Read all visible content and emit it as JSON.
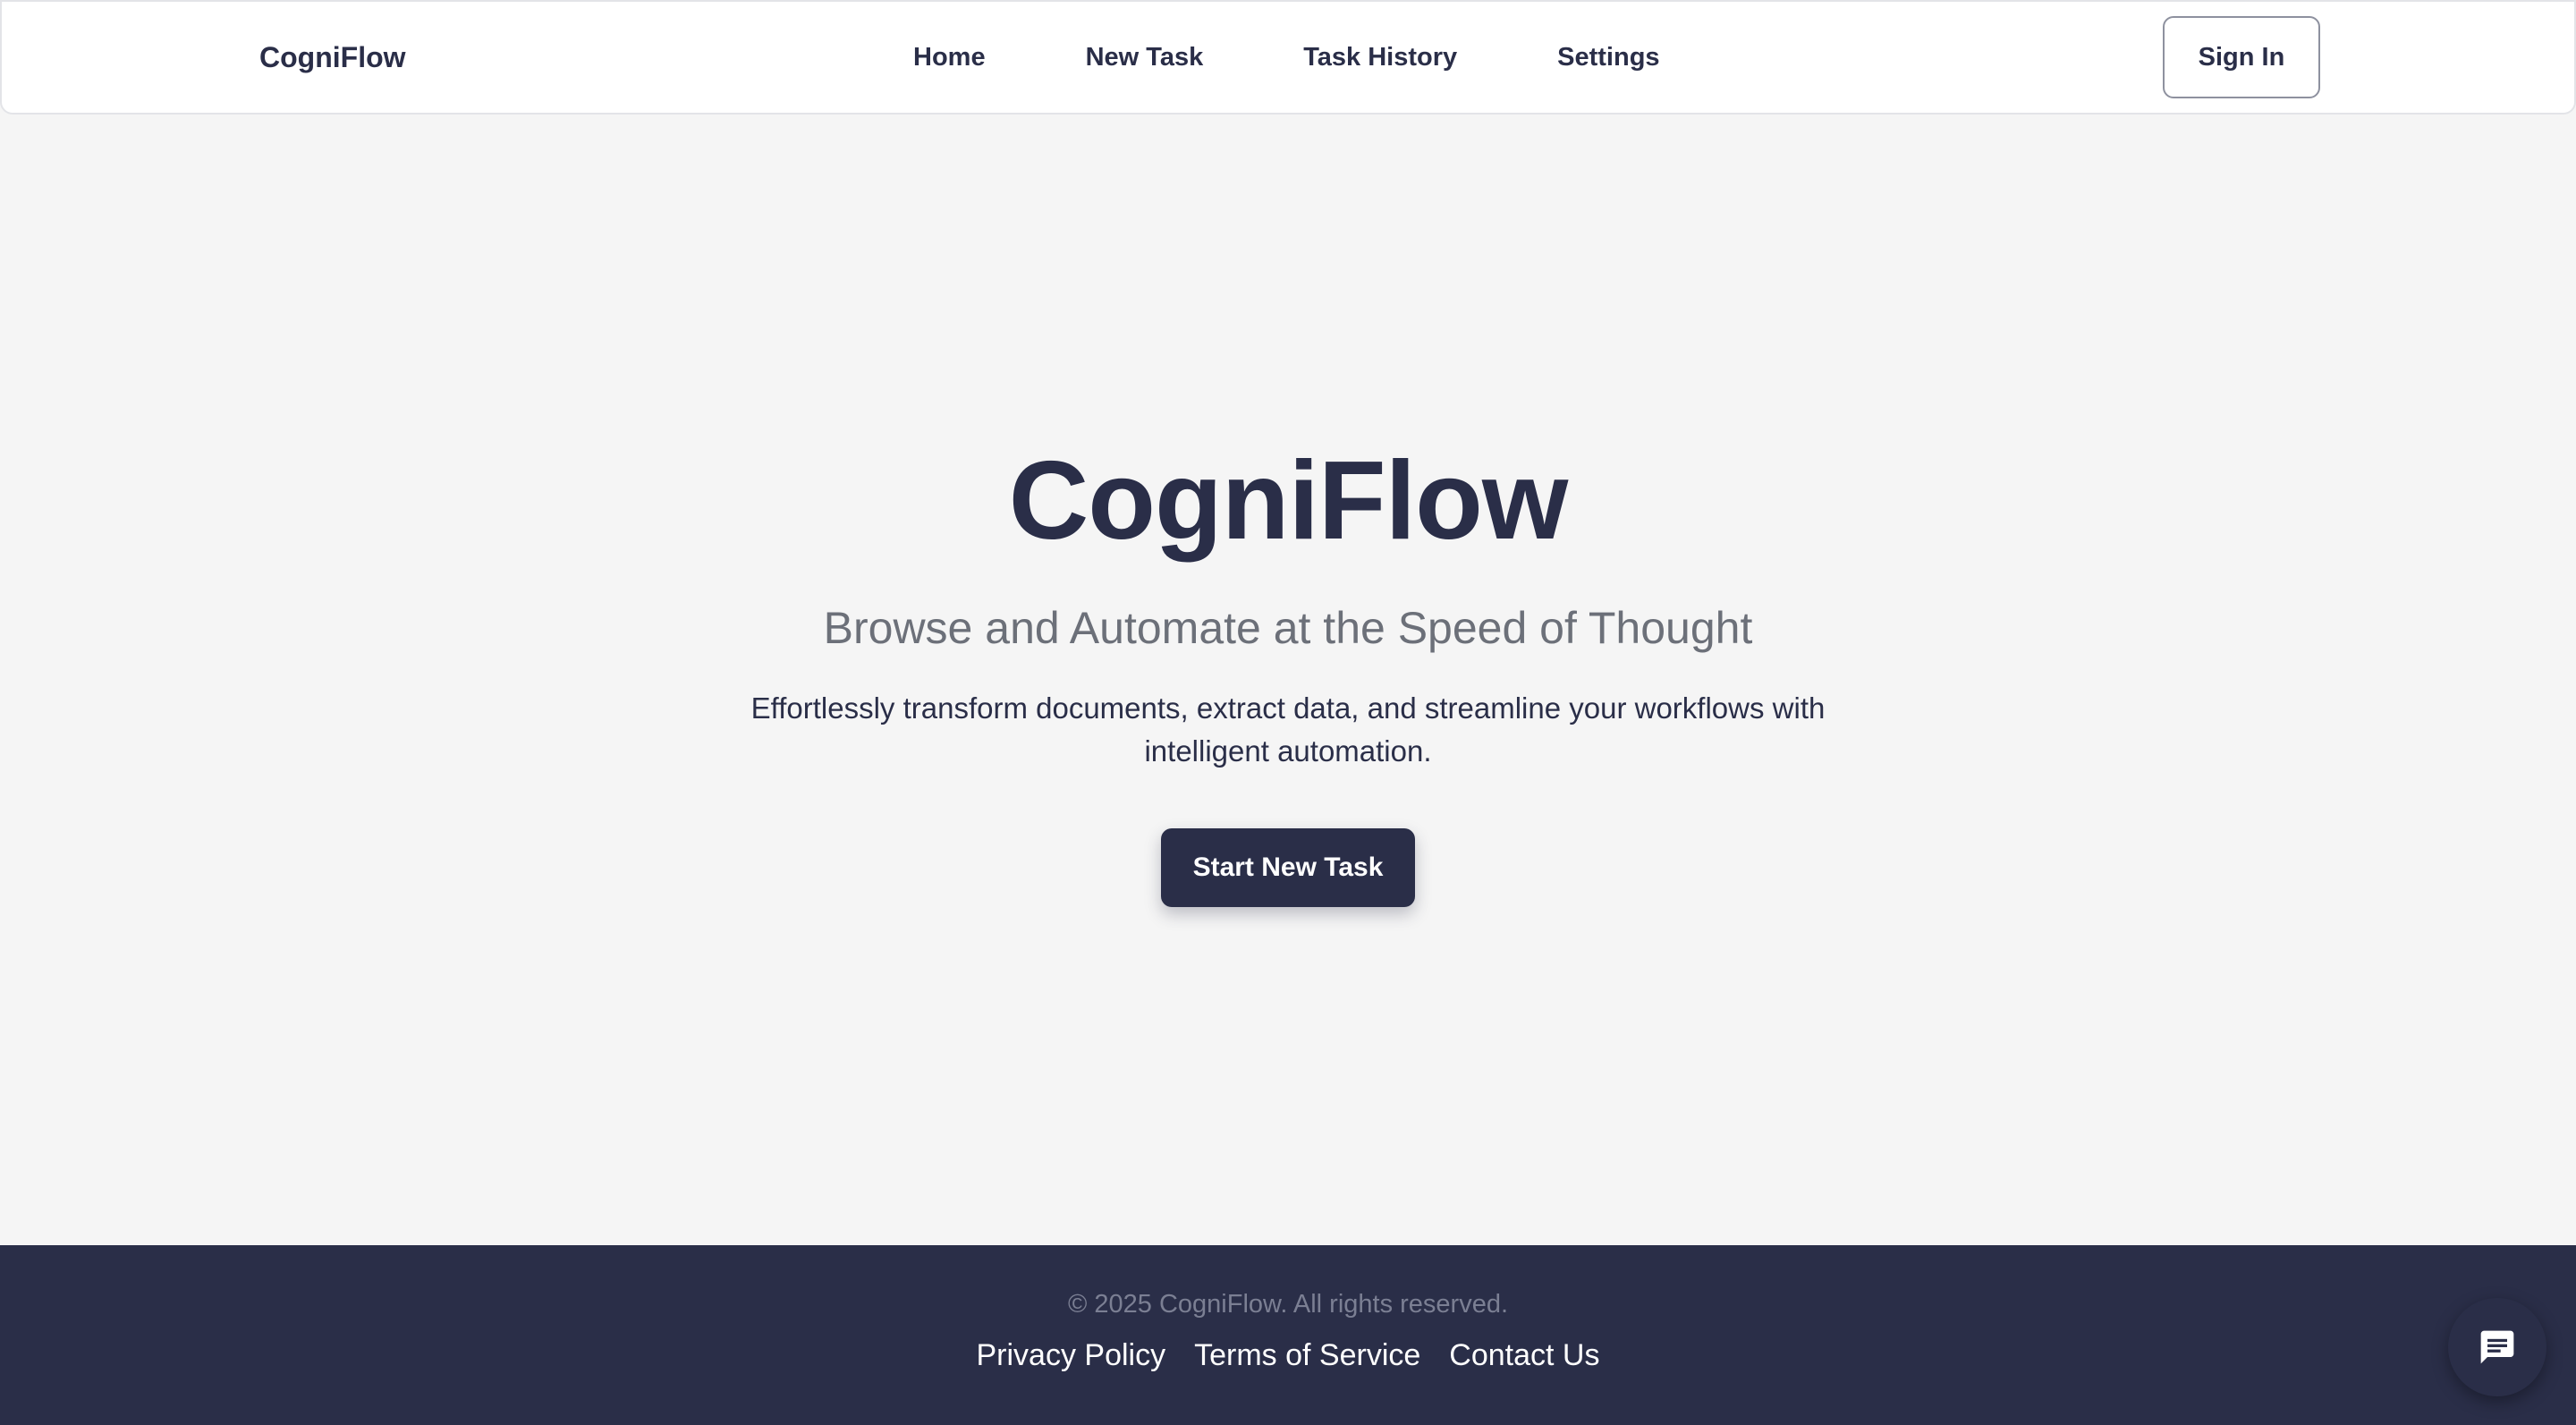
{
  "header": {
    "brand": "CogniFlow",
    "nav": [
      "Home",
      "New Task",
      "Task History",
      "Settings"
    ],
    "signin_label": "Sign In"
  },
  "hero": {
    "title": "CogniFlow",
    "subtitle": "Browse and Automate at the Speed of Thought",
    "description": "Effortlessly transform documents, extract data, and streamline your workflows with intelligent automation.",
    "cta_label": "Start New Task"
  },
  "footer": {
    "copyright": "© 2025 CogniFlow. All rights reserved.",
    "links": [
      "Privacy Policy",
      "Terms of Service",
      "Contact Us"
    ]
  },
  "chat": {
    "icon": "chat-icon"
  },
  "colors": {
    "primary": "#2a2e48",
    "background": "#f5f5f5",
    "header_bg": "#ffffff",
    "muted_text": "#6c7079"
  }
}
